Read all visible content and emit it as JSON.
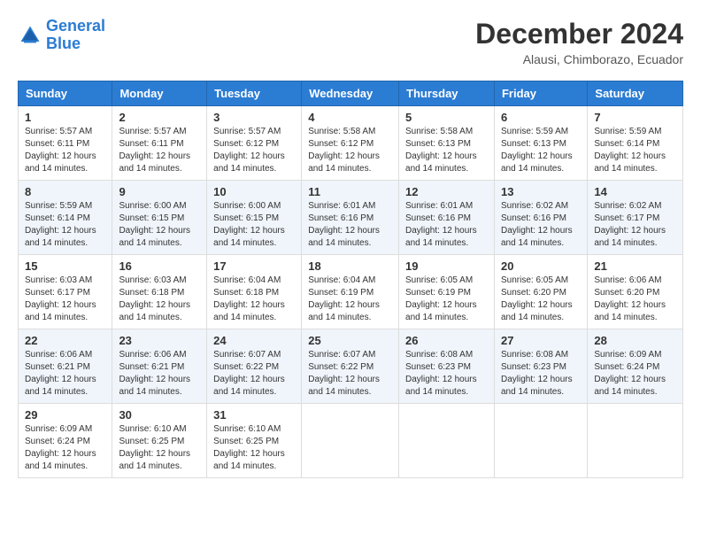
{
  "logo": {
    "line1": "General",
    "line2": "Blue"
  },
  "title": "December 2024",
  "subtitle": "Alausi, Chimborazo, Ecuador",
  "days_of_week": [
    "Sunday",
    "Monday",
    "Tuesday",
    "Wednesday",
    "Thursday",
    "Friday",
    "Saturday"
  ],
  "weeks": [
    [
      {
        "day": "1",
        "sunrise": "5:57 AM",
        "sunset": "6:11 PM",
        "daylight": "12 hours and 14 minutes."
      },
      {
        "day": "2",
        "sunrise": "5:57 AM",
        "sunset": "6:11 PM",
        "daylight": "12 hours and 14 minutes."
      },
      {
        "day": "3",
        "sunrise": "5:57 AM",
        "sunset": "6:12 PM",
        "daylight": "12 hours and 14 minutes."
      },
      {
        "day": "4",
        "sunrise": "5:58 AM",
        "sunset": "6:12 PM",
        "daylight": "12 hours and 14 minutes."
      },
      {
        "day": "5",
        "sunrise": "5:58 AM",
        "sunset": "6:13 PM",
        "daylight": "12 hours and 14 minutes."
      },
      {
        "day": "6",
        "sunrise": "5:59 AM",
        "sunset": "6:13 PM",
        "daylight": "12 hours and 14 minutes."
      },
      {
        "day": "7",
        "sunrise": "5:59 AM",
        "sunset": "6:14 PM",
        "daylight": "12 hours and 14 minutes."
      }
    ],
    [
      {
        "day": "8",
        "sunrise": "5:59 AM",
        "sunset": "6:14 PM",
        "daylight": "12 hours and 14 minutes."
      },
      {
        "day": "9",
        "sunrise": "6:00 AM",
        "sunset": "6:15 PM",
        "daylight": "12 hours and 14 minutes."
      },
      {
        "day": "10",
        "sunrise": "6:00 AM",
        "sunset": "6:15 PM",
        "daylight": "12 hours and 14 minutes."
      },
      {
        "day": "11",
        "sunrise": "6:01 AM",
        "sunset": "6:16 PM",
        "daylight": "12 hours and 14 minutes."
      },
      {
        "day": "12",
        "sunrise": "6:01 AM",
        "sunset": "6:16 PM",
        "daylight": "12 hours and 14 minutes."
      },
      {
        "day": "13",
        "sunrise": "6:02 AM",
        "sunset": "6:16 PM",
        "daylight": "12 hours and 14 minutes."
      },
      {
        "day": "14",
        "sunrise": "6:02 AM",
        "sunset": "6:17 PM",
        "daylight": "12 hours and 14 minutes."
      }
    ],
    [
      {
        "day": "15",
        "sunrise": "6:03 AM",
        "sunset": "6:17 PM",
        "daylight": "12 hours and 14 minutes."
      },
      {
        "day": "16",
        "sunrise": "6:03 AM",
        "sunset": "6:18 PM",
        "daylight": "12 hours and 14 minutes."
      },
      {
        "day": "17",
        "sunrise": "6:04 AM",
        "sunset": "6:18 PM",
        "daylight": "12 hours and 14 minutes."
      },
      {
        "day": "18",
        "sunrise": "6:04 AM",
        "sunset": "6:19 PM",
        "daylight": "12 hours and 14 minutes."
      },
      {
        "day": "19",
        "sunrise": "6:05 AM",
        "sunset": "6:19 PM",
        "daylight": "12 hours and 14 minutes."
      },
      {
        "day": "20",
        "sunrise": "6:05 AM",
        "sunset": "6:20 PM",
        "daylight": "12 hours and 14 minutes."
      },
      {
        "day": "21",
        "sunrise": "6:06 AM",
        "sunset": "6:20 PM",
        "daylight": "12 hours and 14 minutes."
      }
    ],
    [
      {
        "day": "22",
        "sunrise": "6:06 AM",
        "sunset": "6:21 PM",
        "daylight": "12 hours and 14 minutes."
      },
      {
        "day": "23",
        "sunrise": "6:06 AM",
        "sunset": "6:21 PM",
        "daylight": "12 hours and 14 minutes."
      },
      {
        "day": "24",
        "sunrise": "6:07 AM",
        "sunset": "6:22 PM",
        "daylight": "12 hours and 14 minutes."
      },
      {
        "day": "25",
        "sunrise": "6:07 AM",
        "sunset": "6:22 PM",
        "daylight": "12 hours and 14 minutes."
      },
      {
        "day": "26",
        "sunrise": "6:08 AM",
        "sunset": "6:23 PM",
        "daylight": "12 hours and 14 minutes."
      },
      {
        "day": "27",
        "sunrise": "6:08 AM",
        "sunset": "6:23 PM",
        "daylight": "12 hours and 14 minutes."
      },
      {
        "day": "28",
        "sunrise": "6:09 AM",
        "sunset": "6:24 PM",
        "daylight": "12 hours and 14 minutes."
      }
    ],
    [
      {
        "day": "29",
        "sunrise": "6:09 AM",
        "sunset": "6:24 PM",
        "daylight": "12 hours and 14 minutes."
      },
      {
        "day": "30",
        "sunrise": "6:10 AM",
        "sunset": "6:25 PM",
        "daylight": "12 hours and 14 minutes."
      },
      {
        "day": "31",
        "sunrise": "6:10 AM",
        "sunset": "6:25 PM",
        "daylight": "12 hours and 14 minutes."
      },
      null,
      null,
      null,
      null
    ]
  ],
  "labels": {
    "sunrise": "Sunrise:",
    "sunset": "Sunset:",
    "daylight": "Daylight:"
  }
}
